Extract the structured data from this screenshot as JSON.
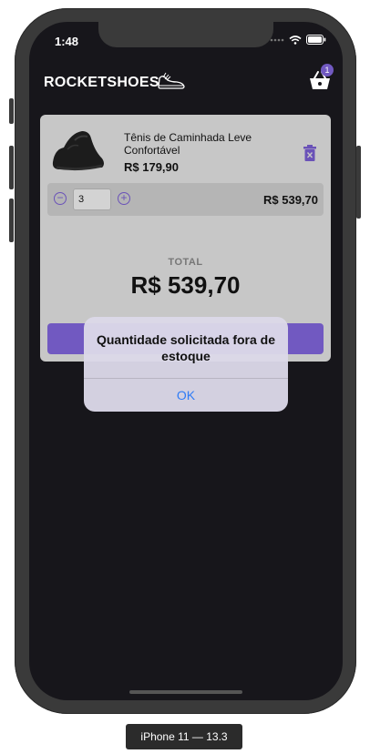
{
  "status_bar": {
    "time": "1:48"
  },
  "header": {
    "title": "ROCKETSHOES",
    "cart_count": "1"
  },
  "cart": {
    "item": {
      "title": "Tênis de Caminhada Leve Confortável",
      "price": "R$ 179,90",
      "quantity": "3",
      "subtotal": "R$ 539,70"
    },
    "total_label": "TOTAL",
    "total_value": "R$ 539,70"
  },
  "alert": {
    "message": "Quantidade solicitada fora de estoque",
    "ok_label": "OK"
  },
  "device_label": "iPhone 11 — 13.3",
  "colors": {
    "accent": "#7159c1",
    "background": "#17161b",
    "card": "#c7c7c7",
    "link": "#2f7cf6"
  }
}
